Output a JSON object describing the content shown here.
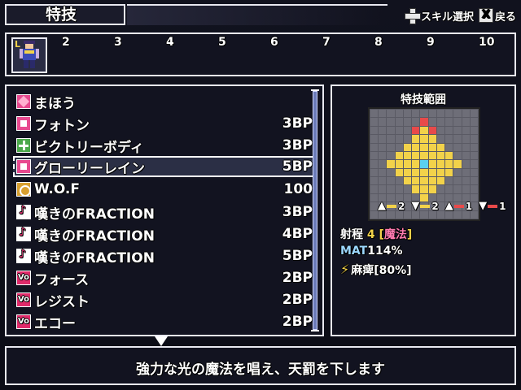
{
  "header": {
    "title": "特技",
    "help": [
      {
        "icon": "dpad-icon",
        "label": "スキル選択"
      },
      {
        "icon": "x-button-icon",
        "button": "X",
        "label": "戻る"
      }
    ]
  },
  "party": {
    "slot1_label": "L",
    "numbers": [
      "2",
      "3",
      "4",
      "5",
      "6",
      "7",
      "8",
      "9",
      "10"
    ]
  },
  "skills": [
    {
      "name": "まほう",
      "cost": "",
      "icon": "magic-category-icon"
    },
    {
      "name": "フォトン",
      "cost": "3BP",
      "icon": "light-skill-icon"
    },
    {
      "name": "ビクトリーボディ",
      "cost": "3BP",
      "icon": "buff-plus-icon"
    },
    {
      "name": "グローリーレイン",
      "cost": "5BP",
      "icon": "light-skill-icon",
      "selected": true
    },
    {
      "name": "W.O.F",
      "cost": "100",
      "icon": "wof-icon"
    },
    {
      "name": "嘆きのFRACTION",
      "cost": "3BP",
      "icon": "music-note-icon"
    },
    {
      "name": "嘆きのFRACTION",
      "cost": "4BP",
      "icon": "music-note-icon"
    },
    {
      "name": "嘆きのFRACTION",
      "cost": "5BP",
      "icon": "music-note-icon"
    },
    {
      "name": "フォース",
      "cost": "2BP",
      "icon": "vo-icon"
    },
    {
      "name": "レジスト",
      "cost": "2BP",
      "icon": "vo-icon"
    },
    {
      "name": "エコー",
      "cost": "2BP",
      "icon": "vo-icon"
    }
  ],
  "range_panel": {
    "title": "特技範囲",
    "markers": [
      {
        "dir": "up",
        "value": "2"
      },
      {
        "dir": "down",
        "value": "2"
      },
      {
        "dir": "up",
        "value": "1"
      },
      {
        "dir": "down",
        "value": "1"
      }
    ],
    "range_label": "射程",
    "range_value": "4",
    "range_type_open": "[",
    "range_type": "魔法",
    "range_type_close": "]",
    "mat_label": "MAT",
    "mat_value": "114%",
    "status_effect": "麻痺[80%]"
  },
  "description": "強力な光の魔法を唱え、天罰を下します",
  "colors": {
    "accent_yellow": "#f2d24a",
    "accent_pink": "#ff7ab0",
    "panel_border": "#e8e8f0",
    "panel_bg": "#121320"
  }
}
